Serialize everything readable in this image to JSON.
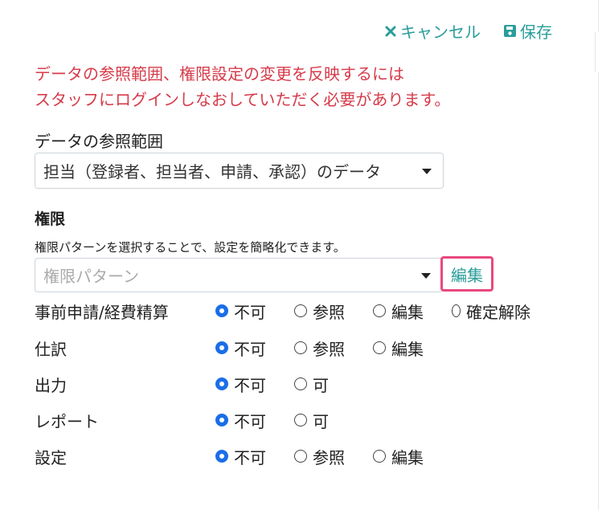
{
  "header": {
    "cancel_label": "キャンセル",
    "save_label": "保存"
  },
  "warning": {
    "line1": "データの参照範囲、権限設定の変更を反映するには",
    "line2": "スタッフにログインしなおしていただく必要があります。"
  },
  "scope": {
    "label": "データの参照範囲",
    "selected": "担当（登録者、担当者、申請、承認）のデータ"
  },
  "permissions": {
    "title": "権限",
    "hint": "権限パターンを選択することで、設定を簡略化できます。",
    "pattern_placeholder": "権限パターン",
    "edit_label": "編集",
    "rows": [
      {
        "label": "事前申請/経費精算",
        "options": [
          "不可",
          "参照",
          "編集",
          "確定解除"
        ],
        "selected": 0
      },
      {
        "label": "仕訳",
        "options": [
          "不可",
          "参照",
          "編集"
        ],
        "selected": 0
      },
      {
        "label": "出力",
        "options": [
          "不可",
          "可"
        ],
        "selected": 0
      },
      {
        "label": "レポート",
        "options": [
          "不可",
          "可"
        ],
        "selected": 0
      },
      {
        "label": "設定",
        "options": [
          "不可",
          "参照",
          "編集"
        ],
        "selected": 0
      }
    ]
  },
  "colors": {
    "accent": "#2a9d9a",
    "warning": "#d63b4a",
    "radio_checked": "#1a6ee8",
    "highlight_border": "#e8497d"
  },
  "icons": {
    "cancel": "close-icon",
    "save": "floppy-disk-icon",
    "dropdown": "caret-down-icon"
  }
}
